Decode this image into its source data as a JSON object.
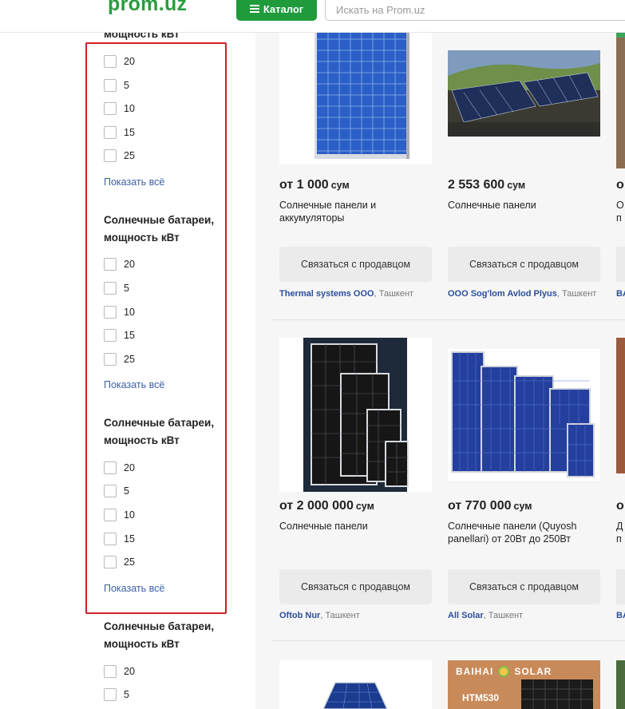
{
  "header": {
    "logo": "prom.uz",
    "catalog_label": "Каталог",
    "search_placeholder": "Искать на Prom.uz"
  },
  "filters": {
    "groups": [
      {
        "title": "мощность кВт",
        "options": [
          "20",
          "5",
          "10",
          "15",
          "25"
        ],
        "show_all": "Показать всё"
      },
      {
        "title_line1": "Солнечные батареи,",
        "title_line2": "мощность кВт",
        "options": [
          "20",
          "5",
          "10",
          "15",
          "25"
        ],
        "show_all": "Показать всё"
      },
      {
        "title_line1": "Солнечные батареи,",
        "title_line2": "мощность кВт",
        "options": [
          "20",
          "5",
          "10",
          "15",
          "25"
        ],
        "show_all": "Показать всё"
      },
      {
        "title_line1": "Солнечные батареи,",
        "title_line2": "мощность кВт",
        "options": [
          "20",
          "5"
        ]
      }
    ]
  },
  "products": [
    {
      "price": "от 1 000",
      "currency": "сум",
      "title": "Солнечные панели и аккумуляторы",
      "contact": "Связаться с продавцом",
      "seller": "Thermal systems OOO",
      "city": ", Ташкент"
    },
    {
      "price": "2 553 600",
      "currency": "сум",
      "title": "Солнечные панели",
      "contact": "Связаться с продавцом",
      "seller": "OOO Sog'lom Avlod Plyus",
      "city": ", Ташкент"
    },
    {
      "price": "от 2 000 000",
      "currency": "сум",
      "title": "Солнечные панели",
      "contact": "Связаться с продавцом",
      "seller": "Oftob Nur",
      "city": ", Ташкент"
    },
    {
      "price": "от 770 000",
      "currency": "сум",
      "title": "Солнечные панели (Quyosh panellari) от 20Вт до 250Вт",
      "contact": "Связаться с продавцом",
      "seller": "All Solar",
      "city": ", Ташкент"
    },
    {
      "banner_brand": "BAIHAI",
      "banner_brand2": "SOLAR",
      "banner_model": "HTM530"
    }
  ],
  "partial_column": {
    "row1": {
      "price": "о",
      "title_line1": "О",
      "title_line2": "п",
      "seller": "BA"
    },
    "row2": {
      "price": "о",
      "title_line1": "Д",
      "title_line2": "п",
      "seller": "BA"
    }
  },
  "colors": {
    "brand_green": "#1f9b3b",
    "link_blue": "#2c4f9a",
    "highlight_red": "#d21f23"
  }
}
